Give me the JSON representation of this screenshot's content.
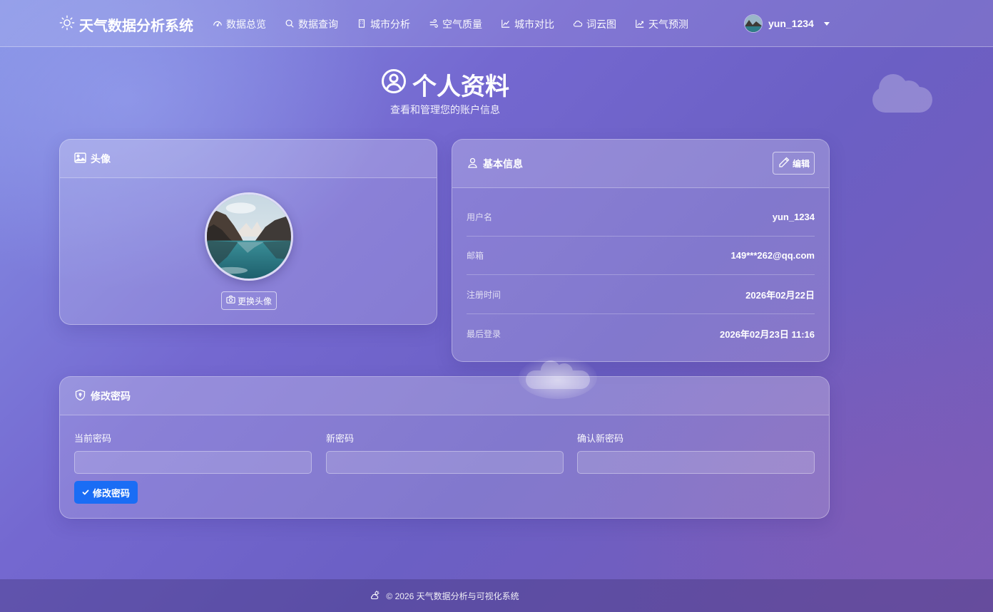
{
  "navbar": {
    "brand": "天气数据分析系统",
    "links": [
      {
        "label": "数据总览",
        "icon": "gauge-icon"
      },
      {
        "label": "数据查询",
        "icon": "search-icon"
      },
      {
        "label": "城市分析",
        "icon": "building-icon"
      },
      {
        "label": "空气质量",
        "icon": "wind-icon"
      },
      {
        "label": "城市对比",
        "icon": "line-chart-icon"
      },
      {
        "label": "词云图",
        "icon": "cloud-icon"
      },
      {
        "label": "天气预测",
        "icon": "trend-chart-icon"
      }
    ],
    "user": {
      "name": "yun_1234"
    }
  },
  "page": {
    "title": "个人资料",
    "subtitle": "查看和管理您的账户信息"
  },
  "avatar_card": {
    "title": "头像",
    "change_button": "更换头像"
  },
  "info_card": {
    "title": "基本信息",
    "edit_button": "编辑",
    "rows": [
      {
        "label": "用户名",
        "value": "yun_1234"
      },
      {
        "label": "邮箱",
        "value": "149***262@qq.com"
      },
      {
        "label": "注册时间",
        "value": "2026年02月22日"
      },
      {
        "label": "最后登录",
        "value": "2026年02月23日 11:16"
      }
    ]
  },
  "password_card": {
    "title": "修改密码",
    "fields": [
      {
        "label": "当前密码",
        "value": ""
      },
      {
        "label": "新密码",
        "value": ""
      },
      {
        "label": "确认新密码",
        "value": ""
      }
    ],
    "submit_button": "修改密码"
  },
  "footer": {
    "text": "© 2026 天气数据分析与可视化系统"
  },
  "colors": {
    "primary_button": "#1a6df5",
    "bg_start": "#8793e6",
    "bg_end": "#7a5cb8"
  }
}
